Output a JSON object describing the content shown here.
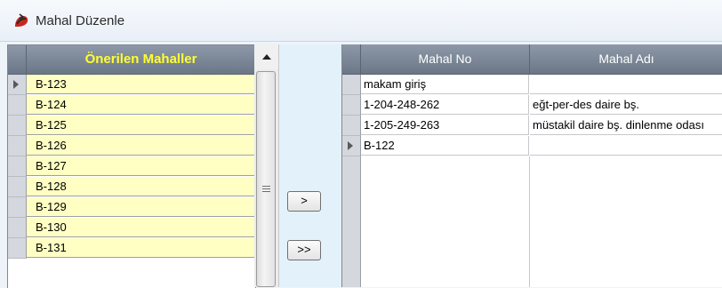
{
  "window": {
    "title": "Mahal Düzenle",
    "icon": "app-logo-icon"
  },
  "left_grid": {
    "header": "Önerilen Mahaller",
    "rows": [
      "B-123",
      "B-124",
      "B-125",
      "B-126",
      "B-127",
      "B-128",
      "B-129",
      "B-130",
      "B-131"
    ]
  },
  "buttons": {
    "move_one": ">",
    "move_all": ">>"
  },
  "right_grid": {
    "columns": [
      "Mahal No",
      "Mahal Adı"
    ],
    "rows": [
      {
        "no": "makam giriş",
        "name": ""
      },
      {
        "no": "1-204-248-262",
        "name": "eğt-per-des daire bş."
      },
      {
        "no": "1-205-249-263",
        "name": "müstakil daire bş. dinlenme odası"
      },
      {
        "no": "B-122",
        "name": ""
      }
    ]
  },
  "colors": {
    "header_text_left": "#ffff2e",
    "cell_bg_left": "#ffffc4",
    "header_bg": "#7b8696"
  }
}
